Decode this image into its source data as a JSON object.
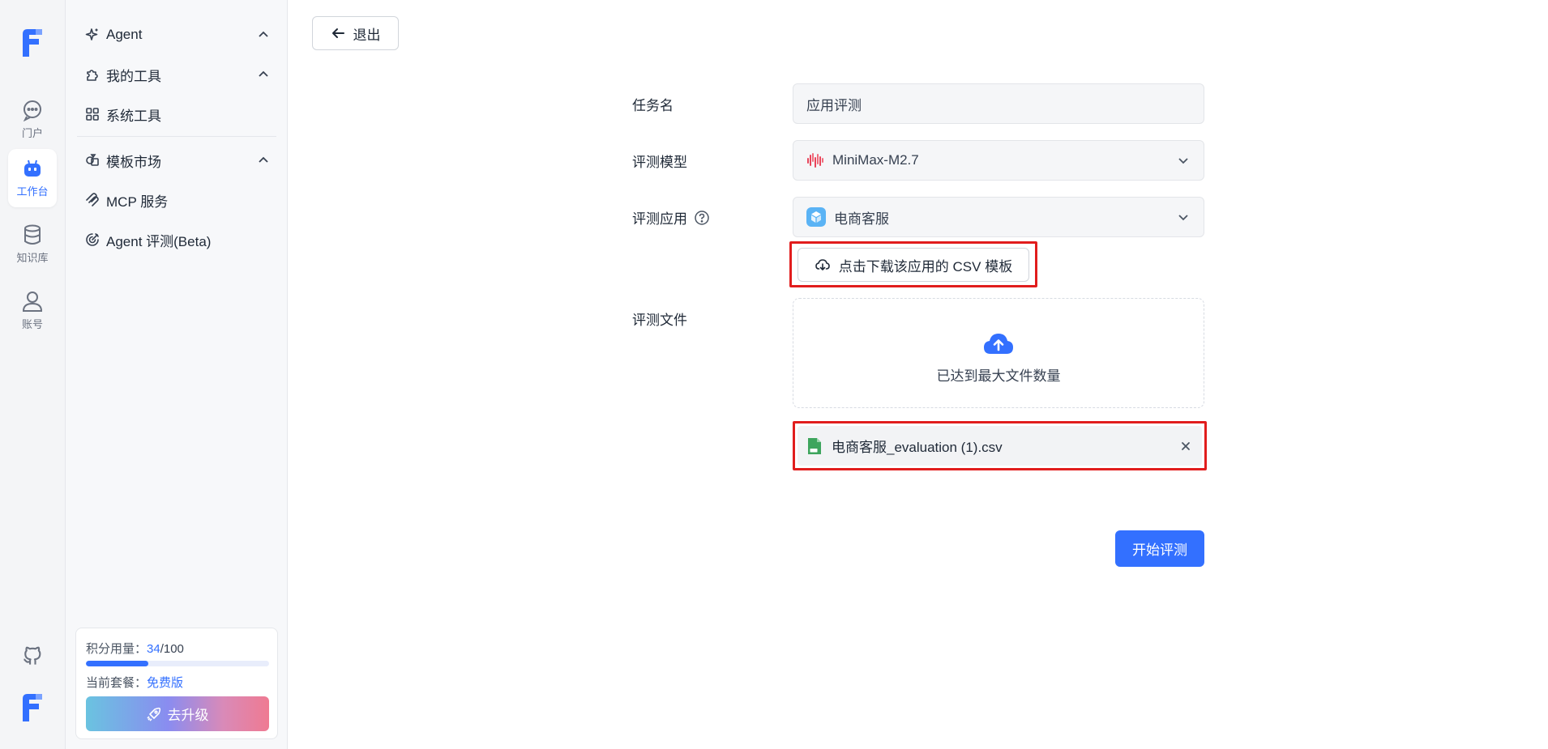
{
  "rail": {
    "items": [
      {
        "label": "门户",
        "icon": "chat-icon"
      },
      {
        "label": "工作台",
        "icon": "robot-icon"
      },
      {
        "label": "知识库",
        "icon": "database-icon"
      },
      {
        "label": "账号",
        "icon": "user-icon"
      }
    ]
  },
  "sidebar": {
    "items": [
      {
        "label": "Agent",
        "icon": "sparkle-icon"
      },
      {
        "label": "我的工具",
        "icon": "puzzle-icon"
      },
      {
        "label": "系统工具",
        "icon": "grid-icon"
      },
      {
        "label": "模板市场",
        "icon": "shapes-icon"
      },
      {
        "label": "MCP 服务",
        "icon": "mcp-icon"
      },
      {
        "label": "Agent 评测(Beta)",
        "icon": "target-icon"
      }
    ],
    "credits": {
      "label": "积分用量：",
      "used": "34",
      "total": "/100",
      "fraction": 0.34,
      "plan_label": "当前套餐：",
      "plan_value": "免费版",
      "upgrade_label": "去升级"
    }
  },
  "header": {
    "back_label": "退出"
  },
  "form": {
    "task_name_label": "任务名",
    "task_name_value": "应用评测",
    "model_label": "评测模型",
    "model_value": "MiniMax-M2.7",
    "app_label": "评测应用",
    "app_value": "电商客服",
    "download_label": "点击下载该应用的 CSV 模板",
    "file_label": "评测文件",
    "drop_text": "已达到最大文件数量",
    "file_name": "电商客服_evaluation (1).csv",
    "submit_label": "开始评测"
  },
  "colors": {
    "accent": "#3370ff",
    "highlight_border": "#e11d1d"
  }
}
